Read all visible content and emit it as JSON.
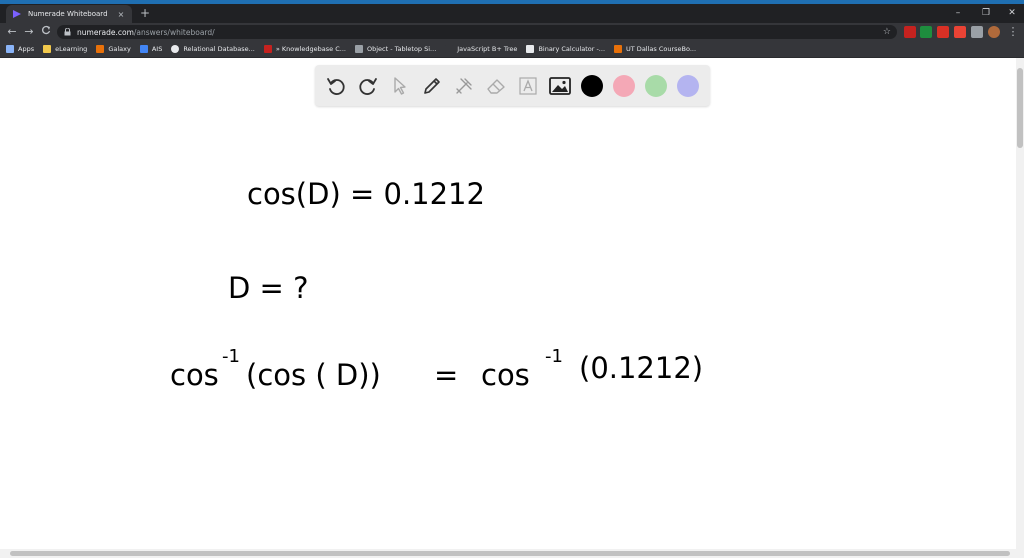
{
  "browser": {
    "tab": {
      "title": "Numerade Whiteboard",
      "close": "×"
    },
    "new_tab": "+",
    "window_controls": {
      "minimize": "–",
      "restore": "❐",
      "close": "✕"
    },
    "nav": {
      "back": "←",
      "forward": "→",
      "reload": "C"
    },
    "address": {
      "host": "numerade.com",
      "path": "/answers/whiteboard/"
    },
    "star": "☆",
    "bookmarks": [
      {
        "label": "Apps",
        "color": "#8ab4f8"
      },
      {
        "label": "eLearning",
        "color": "#f2c94c"
      },
      {
        "label": "Galaxy",
        "color": "#e8710a"
      },
      {
        "label": "AIS",
        "color": "#4285f4"
      },
      {
        "label": "Relational Database...",
        "color": "#e8eaed"
      },
      {
        "label": "» Knowledgebase C...",
        "color": "#c5221f"
      },
      {
        "label": "Object - Tabletop Si...",
        "color": "#9aa0a6"
      },
      {
        "label": "JavaScript B+ Tree",
        "color": "#35363a"
      },
      {
        "label": "Binary Calculator -...",
        "color": "#e8eaed"
      },
      {
        "label": "UT Dallas CourseBo...",
        "color": "#e8710a"
      }
    ]
  },
  "whiteboard": {
    "tools": [
      "undo-icon",
      "redo-icon",
      "select-icon",
      "pen-icon",
      "tools-icon",
      "eraser-icon",
      "text-icon",
      "image-icon"
    ],
    "colors": [
      "#000000",
      "#f4a8b6",
      "#a8dba8",
      "#b4b4f0"
    ],
    "handwriting": {
      "line1": "cos(D) = 0.1212",
      "line2": "D = ?",
      "line3_left": "cos",
      "line3_left_sup": "-1",
      "line3_left_arg": "(cos ( D))",
      "line3_eq": "=",
      "line3_right": "cos",
      "line3_right_sup": "-1",
      "line3_right_arg": "(0.1212)"
    }
  }
}
